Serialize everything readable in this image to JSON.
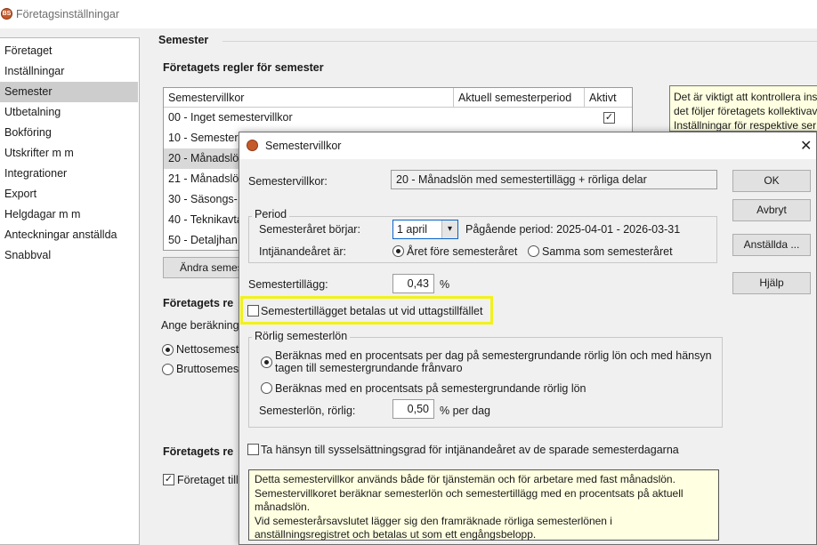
{
  "window": {
    "title": "Företagsinställningar"
  },
  "nav": {
    "items": [
      "Företaget",
      "Inställningar",
      "Semester",
      "Utbetalning",
      "Bokföring",
      "Utskrifter m m",
      "Integrationer",
      "Export",
      "Helgdagar m m",
      "Anteckningar anställda",
      "Snabbval"
    ],
    "selected": "Semester"
  },
  "section": {
    "title": "Semester"
  },
  "rules": {
    "heading": "Företagets regler för semester",
    "columns": [
      "Semestervillkor",
      "Aktuell semesterperiod",
      "Aktivt"
    ],
    "rows": [
      {
        "name": "00 - Inget semestervillkor",
        "active": true
      },
      {
        "name": "10 - Semester",
        "active": false
      },
      {
        "name": "20 - Månadslö",
        "active": false
      },
      {
        "name": "21 - Månadslö",
        "active": false
      },
      {
        "name": "30 - Säsongs-",
        "active": false
      },
      {
        "name": "40 - Teknikavta",
        "active": false
      },
      {
        "name": "50 - Detaljhan",
        "active": false
      }
    ],
    "change_button": "Ändra semest"
  },
  "calc": {
    "heading": "Företagets re",
    "prompt": "Ange beräkning",
    "option_net": "Nettosemest",
    "option_gross": "Bruttosemes"
  },
  "other": {
    "heading": "Företagets re",
    "checkbox": "Företaget till"
  },
  "info": {
    "lines": [
      "Det är viktigt att kontrollera inst",
      "det följer företagets kollektivav",
      "Inställningar för respektive ser"
    ]
  },
  "dialog": {
    "title": "Semestervillkor",
    "villkor_label": "Semestervillkor:",
    "villkor_value": "20 - Månadslön med semestertillägg + rörliga delar",
    "period": {
      "label": "Period",
      "start_label": "Semesteråret börjar:",
      "start_value": "1 april",
      "current_period": "Pågående period: 2025-04-01 - 2026-03-31",
      "earning_label": "Intjänandeåret är:",
      "earning_option_before": "Året före semesteråret",
      "earning_option_same": "Samma som semesteråret"
    },
    "supplement_label": "Semestertillägg:",
    "supplement_value": "0,43",
    "supplement_unit": "%",
    "paid_checkbox": "Semestertillägget betalas ut vid uttagstillfället",
    "variable": {
      "label": "Rörlig semesterlön",
      "option_per_day_1": "Beräknas med en procentsats per dag på semestergrundande rörlig lön och med hänsyn",
      "option_per_day_2": "tagen till semestergrundande frånvaro",
      "option_pct": "Beräknas med en procentsats på semestergrundande rörlig lön",
      "rate_label": "Semesterlön, rörlig:",
      "rate_value": "0,50",
      "rate_unit": "% per dag"
    },
    "employment_checkbox": "Ta hänsyn till sysselsättningsgrad för intjänandeåret av de sparade semesterdagarna",
    "note_lines": [
      "Detta semestervillkor används både för tjänstemän och för arbetare med fast månadslön.",
      "Semestervillkoret beräknar semesterlön och semestertillägg med en procentsats på aktuell",
      "månadslön.",
      "Vid semesterårsavslutet lägger sig den framräknade rörliga semesterlönen i",
      "anställningsregistret och betalas ut som ett engångsbelopp."
    ],
    "buttons": {
      "ok": "OK",
      "cancel": "Avbryt",
      "employees": "Anställda ...",
      "help": "Hjälp"
    }
  }
}
